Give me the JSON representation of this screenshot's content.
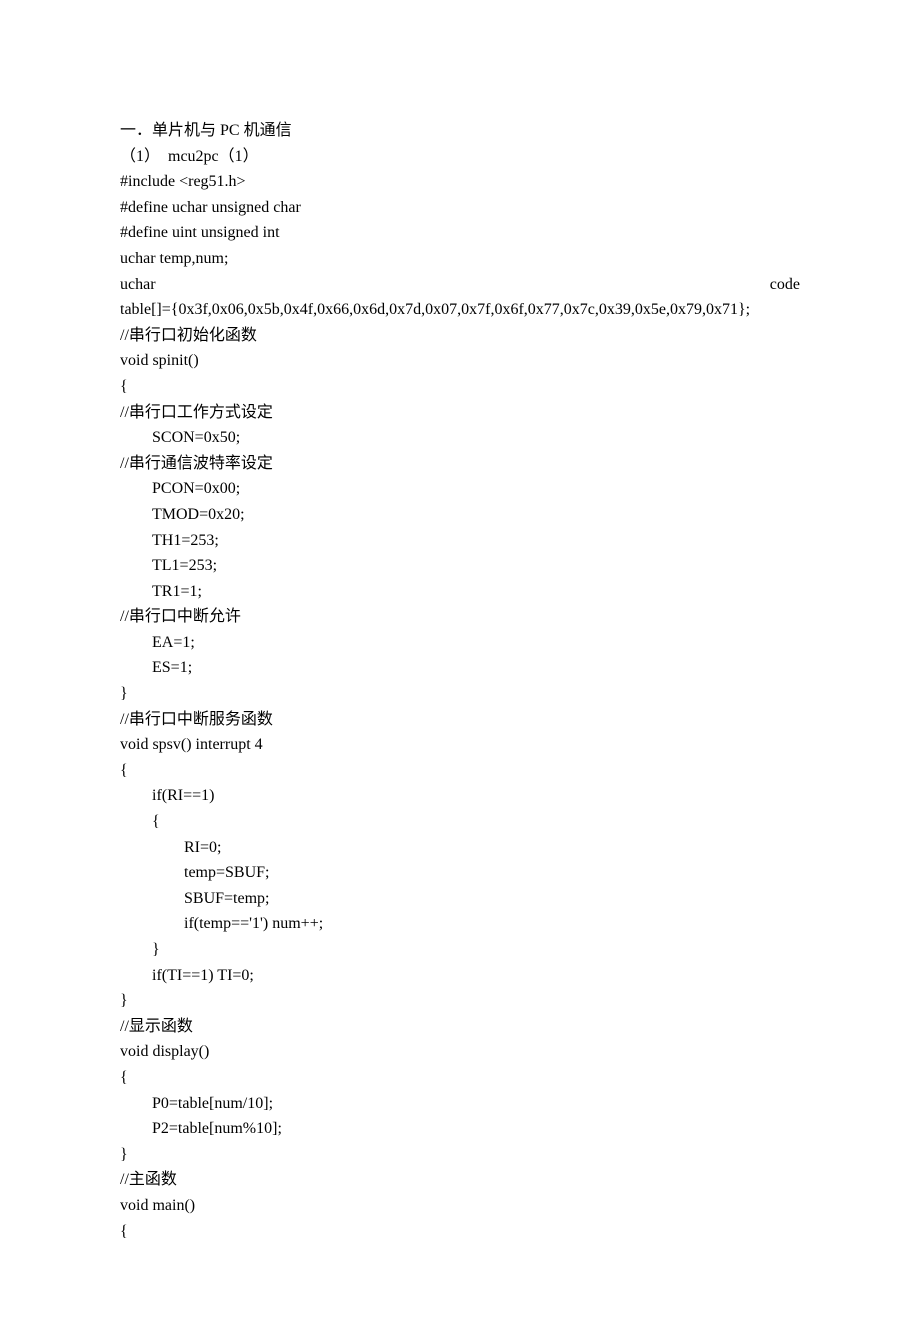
{
  "lines": [
    {
      "text": "一．单片机与 PC 机通信",
      "style": "line"
    },
    {
      "text": "（1）  mcu2pc（1）",
      "style": "line"
    },
    {
      "text": "#include <reg51.h>",
      "style": "line"
    },
    {
      "text": "#define uchar unsigned char",
      "style": "line"
    },
    {
      "text": "#define uint unsigned int",
      "style": "line"
    },
    {
      "text": "uchar temp,num;",
      "style": "line"
    },
    {
      "justify": true,
      "left": "uchar",
      "right": "code"
    },
    {
      "text": "table[]={0x3f,0x06,0x5b,0x4f,0x66,0x6d,0x7d,0x07,0x7f,0x6f,0x77,0x7c,0x39,0x5e,0x79,0x71};",
      "style": "line"
    },
    {
      "text": "//串行口初始化函数",
      "style": "line"
    },
    {
      "text": "void spinit()",
      "style": "line"
    },
    {
      "text": "{",
      "style": "line"
    },
    {
      "text": "//串行口工作方式设定",
      "style": "line"
    },
    {
      "text": "SCON=0x50;",
      "style": "line indent1"
    },
    {
      "text": "//串行通信波特率设定",
      "style": "line"
    },
    {
      "text": "PCON=0x00;",
      "style": "line indent1"
    },
    {
      "text": "TMOD=0x20;",
      "style": "line indent1"
    },
    {
      "text": "TH1=253;",
      "style": "line indent1"
    },
    {
      "text": "TL1=253;",
      "style": "line indent1"
    },
    {
      "text": "TR1=1;",
      "style": "line indent1"
    },
    {
      "text": "//串行口中断允许",
      "style": "line"
    },
    {
      "text": "EA=1;",
      "style": "line indent1"
    },
    {
      "text": "ES=1;",
      "style": "line indent1"
    },
    {
      "text": "}",
      "style": "line"
    },
    {
      "text": "//串行口中断服务函数",
      "style": "line"
    },
    {
      "text": "void spsv() interrupt 4",
      "style": "line"
    },
    {
      "text": "{",
      "style": "line"
    },
    {
      "text": "if(RI==1)",
      "style": "line indent1"
    },
    {
      "text": "{",
      "style": "line indent1"
    },
    {
      "text": "RI=0;",
      "style": "line indent2"
    },
    {
      "text": "temp=SBUF;",
      "style": "line indent2"
    },
    {
      "text": "SBUF=temp;",
      "style": "line indent2"
    },
    {
      "text": "if(temp=='1') num++;",
      "style": "line indent2"
    },
    {
      "text": "}",
      "style": "line indent1"
    },
    {
      "text": "if(TI==1) TI=0;",
      "style": "line indent1"
    },
    {
      "text": "}",
      "style": "line"
    },
    {
      "text": "//显示函数",
      "style": "line"
    },
    {
      "text": "void display()",
      "style": "line"
    },
    {
      "text": "{",
      "style": "line"
    },
    {
      "text": "P0=table[num/10];",
      "style": "line indent1"
    },
    {
      "text": "P2=table[num%10];",
      "style": "line indent1"
    },
    {
      "text": "}",
      "style": "line"
    },
    {
      "text": "//主函数",
      "style": "line"
    },
    {
      "text": "void main()",
      "style": "line"
    },
    {
      "text": "{",
      "style": "line"
    }
  ]
}
